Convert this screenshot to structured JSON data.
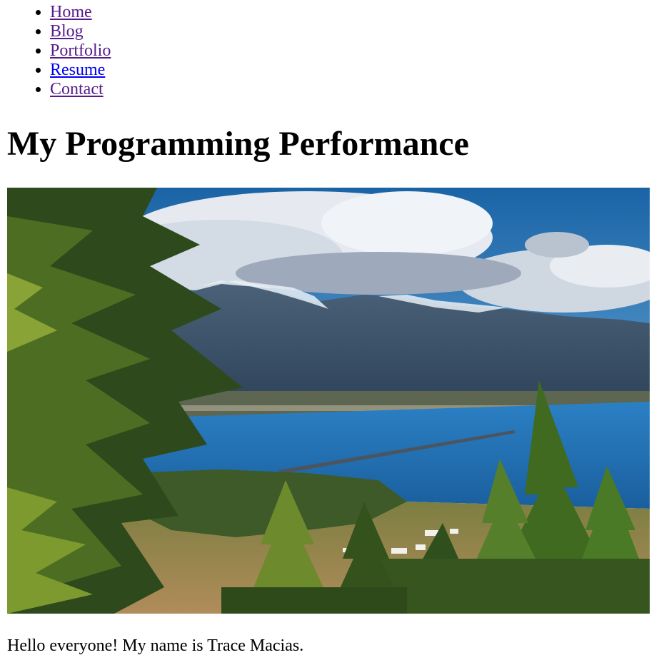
{
  "nav": {
    "items": [
      {
        "label": "Home",
        "visited": true
      },
      {
        "label": "Blog",
        "visited": true
      },
      {
        "label": "Portfolio",
        "visited": true
      },
      {
        "label": "Resume",
        "visited": false
      },
      {
        "label": "Contact",
        "visited": true
      }
    ]
  },
  "page": {
    "title": "My Programming Performance",
    "intro": "Hello everyone! My name is Trace Macias."
  },
  "hero_image": {
    "subject": "landscape photo: lake with long bridge, snowy mountains, evergreen trees",
    "colors": {
      "sky": "#1f6fb0",
      "cloud": "#e8ecf2",
      "mountain": "#3a5166",
      "lake": "#1f72b8",
      "tree": "#3d5a1e",
      "field": "#b08c5a"
    }
  }
}
